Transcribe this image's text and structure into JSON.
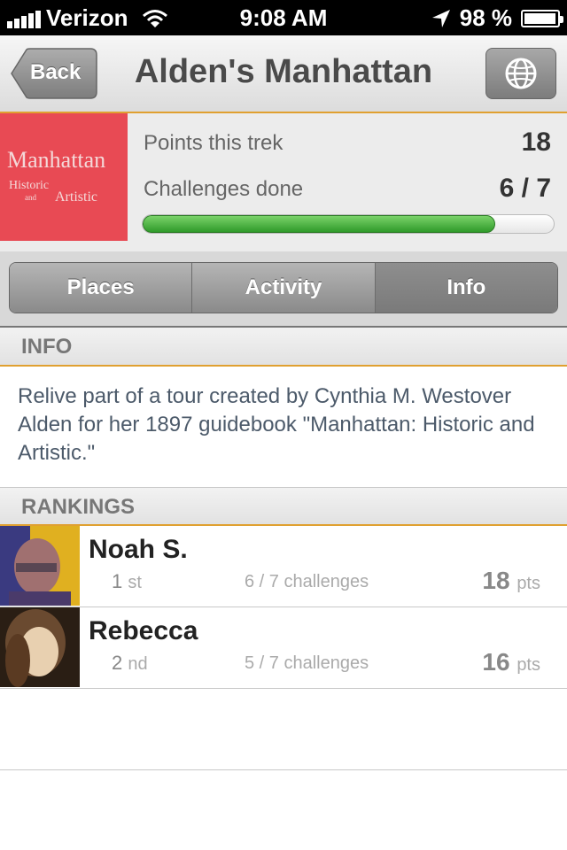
{
  "status_bar": {
    "carrier": "Verizon",
    "time": "9:08 AM",
    "battery_percent": "98 %",
    "battery_level": 0.98
  },
  "nav": {
    "back_label": "Back",
    "title": "Alden's Manhattan",
    "globe_icon": "globe-icon"
  },
  "trek": {
    "cover_title": "Manhattan",
    "cover_line1": "Historic",
    "cover_line2": "and",
    "cover_line3": "Artistic",
    "points_label": "Points this trek",
    "points_value": "18",
    "challenges_label": "Challenges done",
    "challenges_value": "6 / 7",
    "progress_fraction": 0.857,
    "progress_color": "#3fae33"
  },
  "tabs": [
    {
      "label": "Places",
      "selected": false
    },
    {
      "label": "Activity",
      "selected": false
    },
    {
      "label": "Info",
      "selected": true
    }
  ],
  "info": {
    "header": "INFO",
    "text": "Relive part of a tour created by Cynthia M. Westover Alden for her 1897 guidebook \"Manhattan: Historic and Artistic.\""
  },
  "rankings": {
    "header": "RANKINGS",
    "rows": [
      {
        "name": "Noah S.",
        "rank": "1",
        "suffix": "st",
        "challenges": "6 / 7 challenges",
        "points": "18",
        "unit": "pts"
      },
      {
        "name": "Rebecca",
        "rank": "2",
        "suffix": "nd",
        "challenges": "5 / 7 challenges",
        "points": "16",
        "unit": "pts"
      }
    ]
  },
  "colors": {
    "accent_line": "#e0a030",
    "cover_red": "#e84a54"
  }
}
